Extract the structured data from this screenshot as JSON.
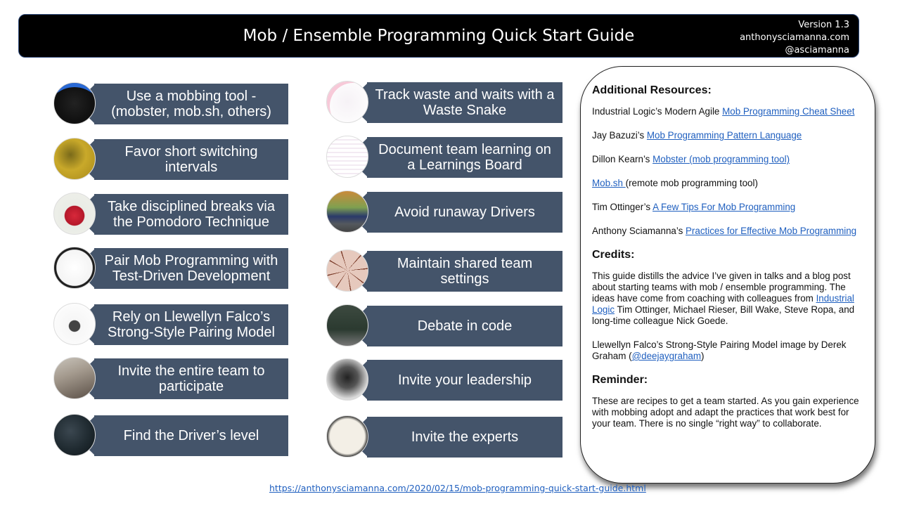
{
  "header": {
    "title": "Mob / Ensemble Programming Quick Start Guide",
    "version": "Version 1.3",
    "website": "anthonysciamanna.com",
    "handle": "@asciamanna"
  },
  "left_tips": [
    {
      "label": "Use a mobbing  tool - (mobster, mob.sh, others)",
      "image": "mobbing-tool-screenshot"
    },
    {
      "label": "Favor short switching intervals",
      "image": "timer-switch-photo"
    },
    {
      "label": "Take disciplined breaks via the Pomodoro Technique",
      "image": "pomodoro-tomato-timer"
    },
    {
      "label": "Pair Mob Programming with Test-Driven Development",
      "image": "tdd-cycle-diagram"
    },
    {
      "label": "Rely on Llewellyn Falco’s Strong-Style Pairing Model",
      "image": "strong-style-sketch"
    },
    {
      "label": "Invite the entire team to participate",
      "image": "team-room-photo"
    },
    {
      "label": "Find the Driver’s level",
      "image": "steering-wheel-photo"
    }
  ],
  "right_tips": [
    {
      "label": "Track waste and waits with a Waste Snake",
      "image": "waste-snake-board"
    },
    {
      "label": "Document team learning on a Learnings Board",
      "image": "learnings-board"
    },
    {
      "label": "Avoid runaway Drivers",
      "image": "speeding-car-photo"
    },
    {
      "label": "Maintain shared team settings",
      "image": "sliced-pie-photo"
    },
    {
      "label": "Debate in code",
      "image": "chalkboard-photo"
    },
    {
      "label": "Invite your leadership",
      "image": "leader-photo"
    },
    {
      "label": "Invite the experts",
      "image": "ask-the-experts-sign"
    }
  ],
  "resources": {
    "heading": "Additional Resources:",
    "items": [
      {
        "prefix": "Industrial Logic’s Modern Agile ",
        "link": "Mob Programming Cheat Sheet",
        "suffix": ""
      },
      {
        "prefix": "Jay Bazuzi’s  ",
        "link": "Mob Programming Pattern Language",
        "suffix": ""
      },
      {
        "prefix": "Dillon Kearn’s ",
        "link": "Mobster (mob programming tool)",
        "suffix": ""
      },
      {
        "prefix": "",
        "link": "Mob.sh ",
        "suffix": "(remote mob programming tool)"
      },
      {
        "prefix": "Tim Ottinger’s ",
        "link": "A Few Tips For Mob Programming",
        "suffix": ""
      },
      {
        "prefix": "Anthony Sciamanna’s  ",
        "link": "Practices for Effective Mob Programming",
        "suffix": ""
      }
    ]
  },
  "credits": {
    "heading": "Credits:",
    "p1_before": "This guide distills the advice I’ve given in talks and a blog post about starting teams with mob / ensemble programming. The ideas have come from coaching with colleagues from ",
    "p1_link": "Industrial Logic",
    "p1_after": " Tim Ottinger, Michael Rieser, Bill Wake, Steve Ropa, and long-time colleague Nick Goede.",
    "p2_before": "Llewellyn Falco’s Strong-Style Pairing Model image by Derek Graham (",
    "p2_link": "@deejaygraham",
    "p2_after": ")"
  },
  "reminder": {
    "heading": "Reminder:",
    "text": "These are recipes to get a team started. As you gain experience with mobbing adopt and adapt the practices that work best for your team. There is no single “right way” to collaborate."
  },
  "footer": {
    "url": "https://anthonysciamanna.com/2020/02/15/mob-programming-quick-start-guide.html"
  },
  "colors": {
    "banner": "#44546a",
    "link": "#1f5fbf",
    "header_bg": "#000000"
  }
}
